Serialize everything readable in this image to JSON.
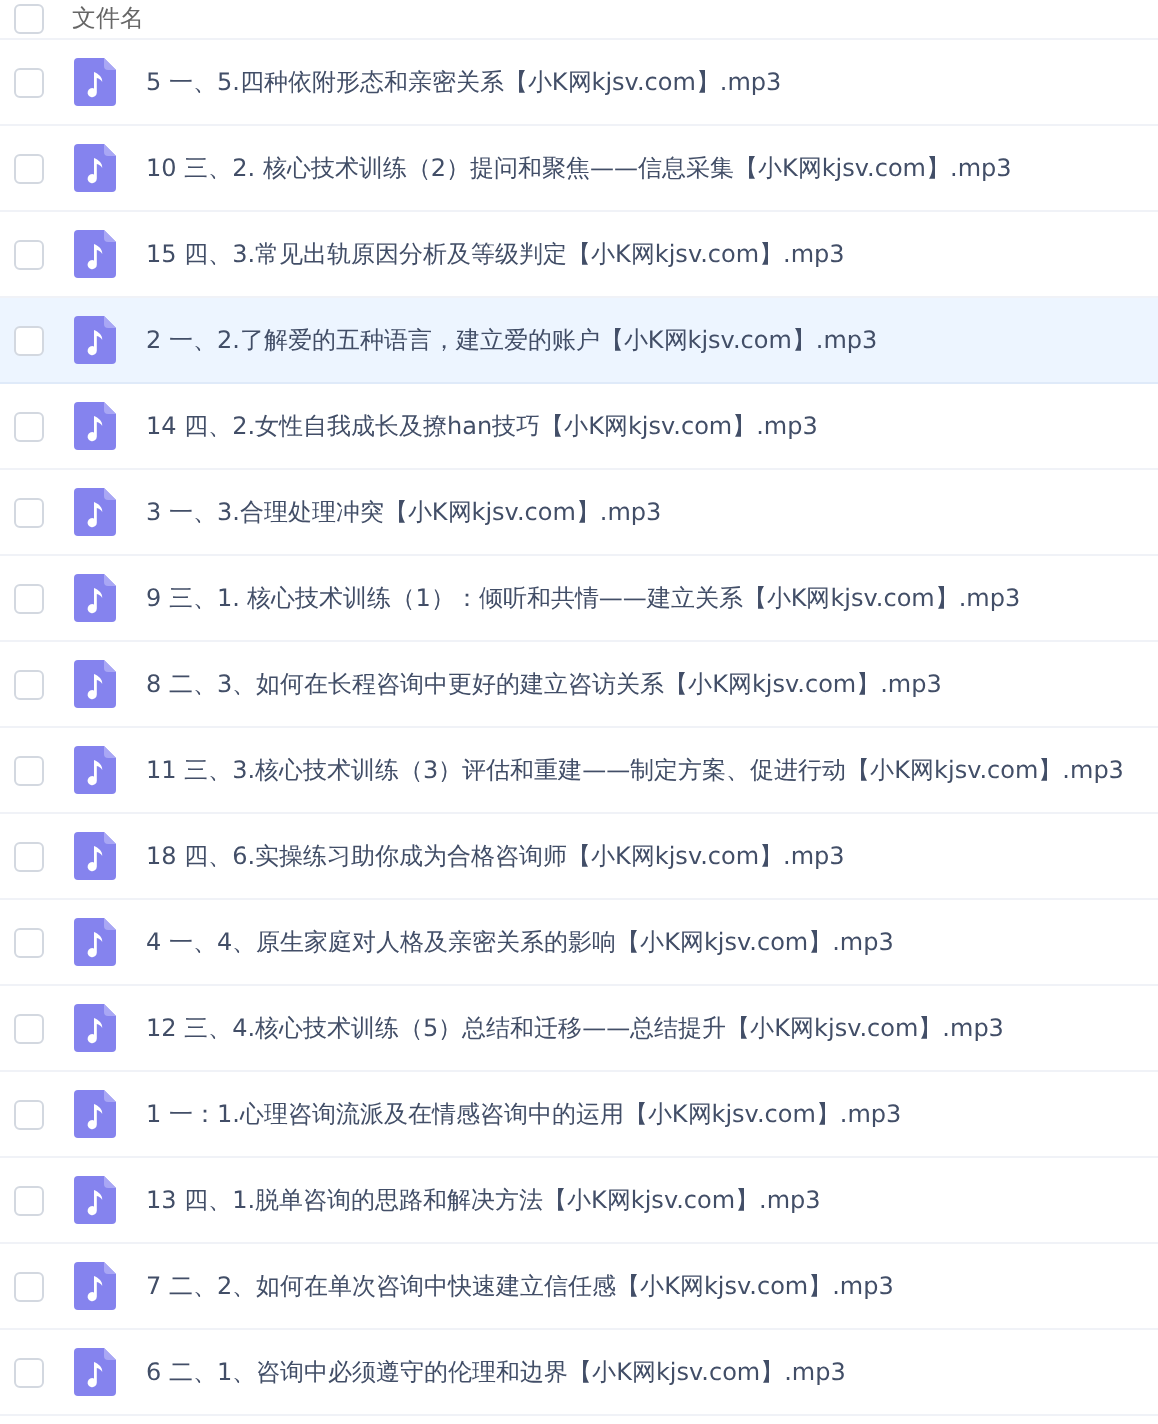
{
  "header": {
    "select_all_checked": false,
    "label": "文件名"
  },
  "files": [
    {
      "name": "5 一、5.四种依附形态和亲密关系【小K网kjsv.com】.mp3",
      "checked": false,
      "selected": false
    },
    {
      "name": "10 三、2. 核心技术训练（2）提问和聚焦——信息采集【小K网kjsv.com】.mp3",
      "checked": false,
      "selected": false
    },
    {
      "name": "15 四、3.常见出轨原因分析及等级判定【小K网kjsv.com】.mp3",
      "checked": false,
      "selected": false
    },
    {
      "name": "2 一、2.了解爱的五种语言，建立爱的账户【小K网kjsv.com】.mp3",
      "checked": false,
      "selected": true
    },
    {
      "name": "14 四、2.女性自我成长及撩han技巧【小K网kjsv.com】.mp3",
      "checked": false,
      "selected": false
    },
    {
      "name": "3 一、3.合理处理冲突【小K网kjsv.com】.mp3",
      "checked": false,
      "selected": false
    },
    {
      "name": "9 三、1. 核心技术训练（1）：倾听和共情——建立关系【小K网kjsv.com】.mp3",
      "checked": false,
      "selected": false
    },
    {
      "name": "8 二、3、如何在长程咨询中更好的建立咨访关系【小K网kjsv.com】.mp3",
      "checked": false,
      "selected": false
    },
    {
      "name": "11 三、3.核心技术训练（3）评估和重建——制定方案、促进行动【小K网kjsv.com】.mp3",
      "checked": false,
      "selected": false
    },
    {
      "name": "18 四、6.实操练习助你成为合格咨询师【小K网kjsv.com】.mp3",
      "checked": false,
      "selected": false
    },
    {
      "name": "4 一、4、原生家庭对人格及亲密关系的影响【小K网kjsv.com】.mp3",
      "checked": false,
      "selected": false
    },
    {
      "name": "12 三、4.核心技术训练（5）总结和迁移——总结提升【小K网kjsv.com】.mp3",
      "checked": false,
      "selected": false
    },
    {
      "name": "1 一：1.心理咨询流派及在情感咨询中的运用【小K网kjsv.com】.mp3",
      "checked": false,
      "selected": false
    },
    {
      "name": "13 四、1.脱单咨询的思路和解决方法【小K网kjsv.com】.mp3",
      "checked": false,
      "selected": false
    },
    {
      "name": "7 二、2、如何在单次咨询中快速建立信任感【小K网kjsv.com】.mp3",
      "checked": false,
      "selected": false
    },
    {
      "name": "6 二、1、咨询中必须遵守的伦理和边界【小K网kjsv.com】.mp3",
      "checked": false,
      "selected": false
    }
  ]
}
